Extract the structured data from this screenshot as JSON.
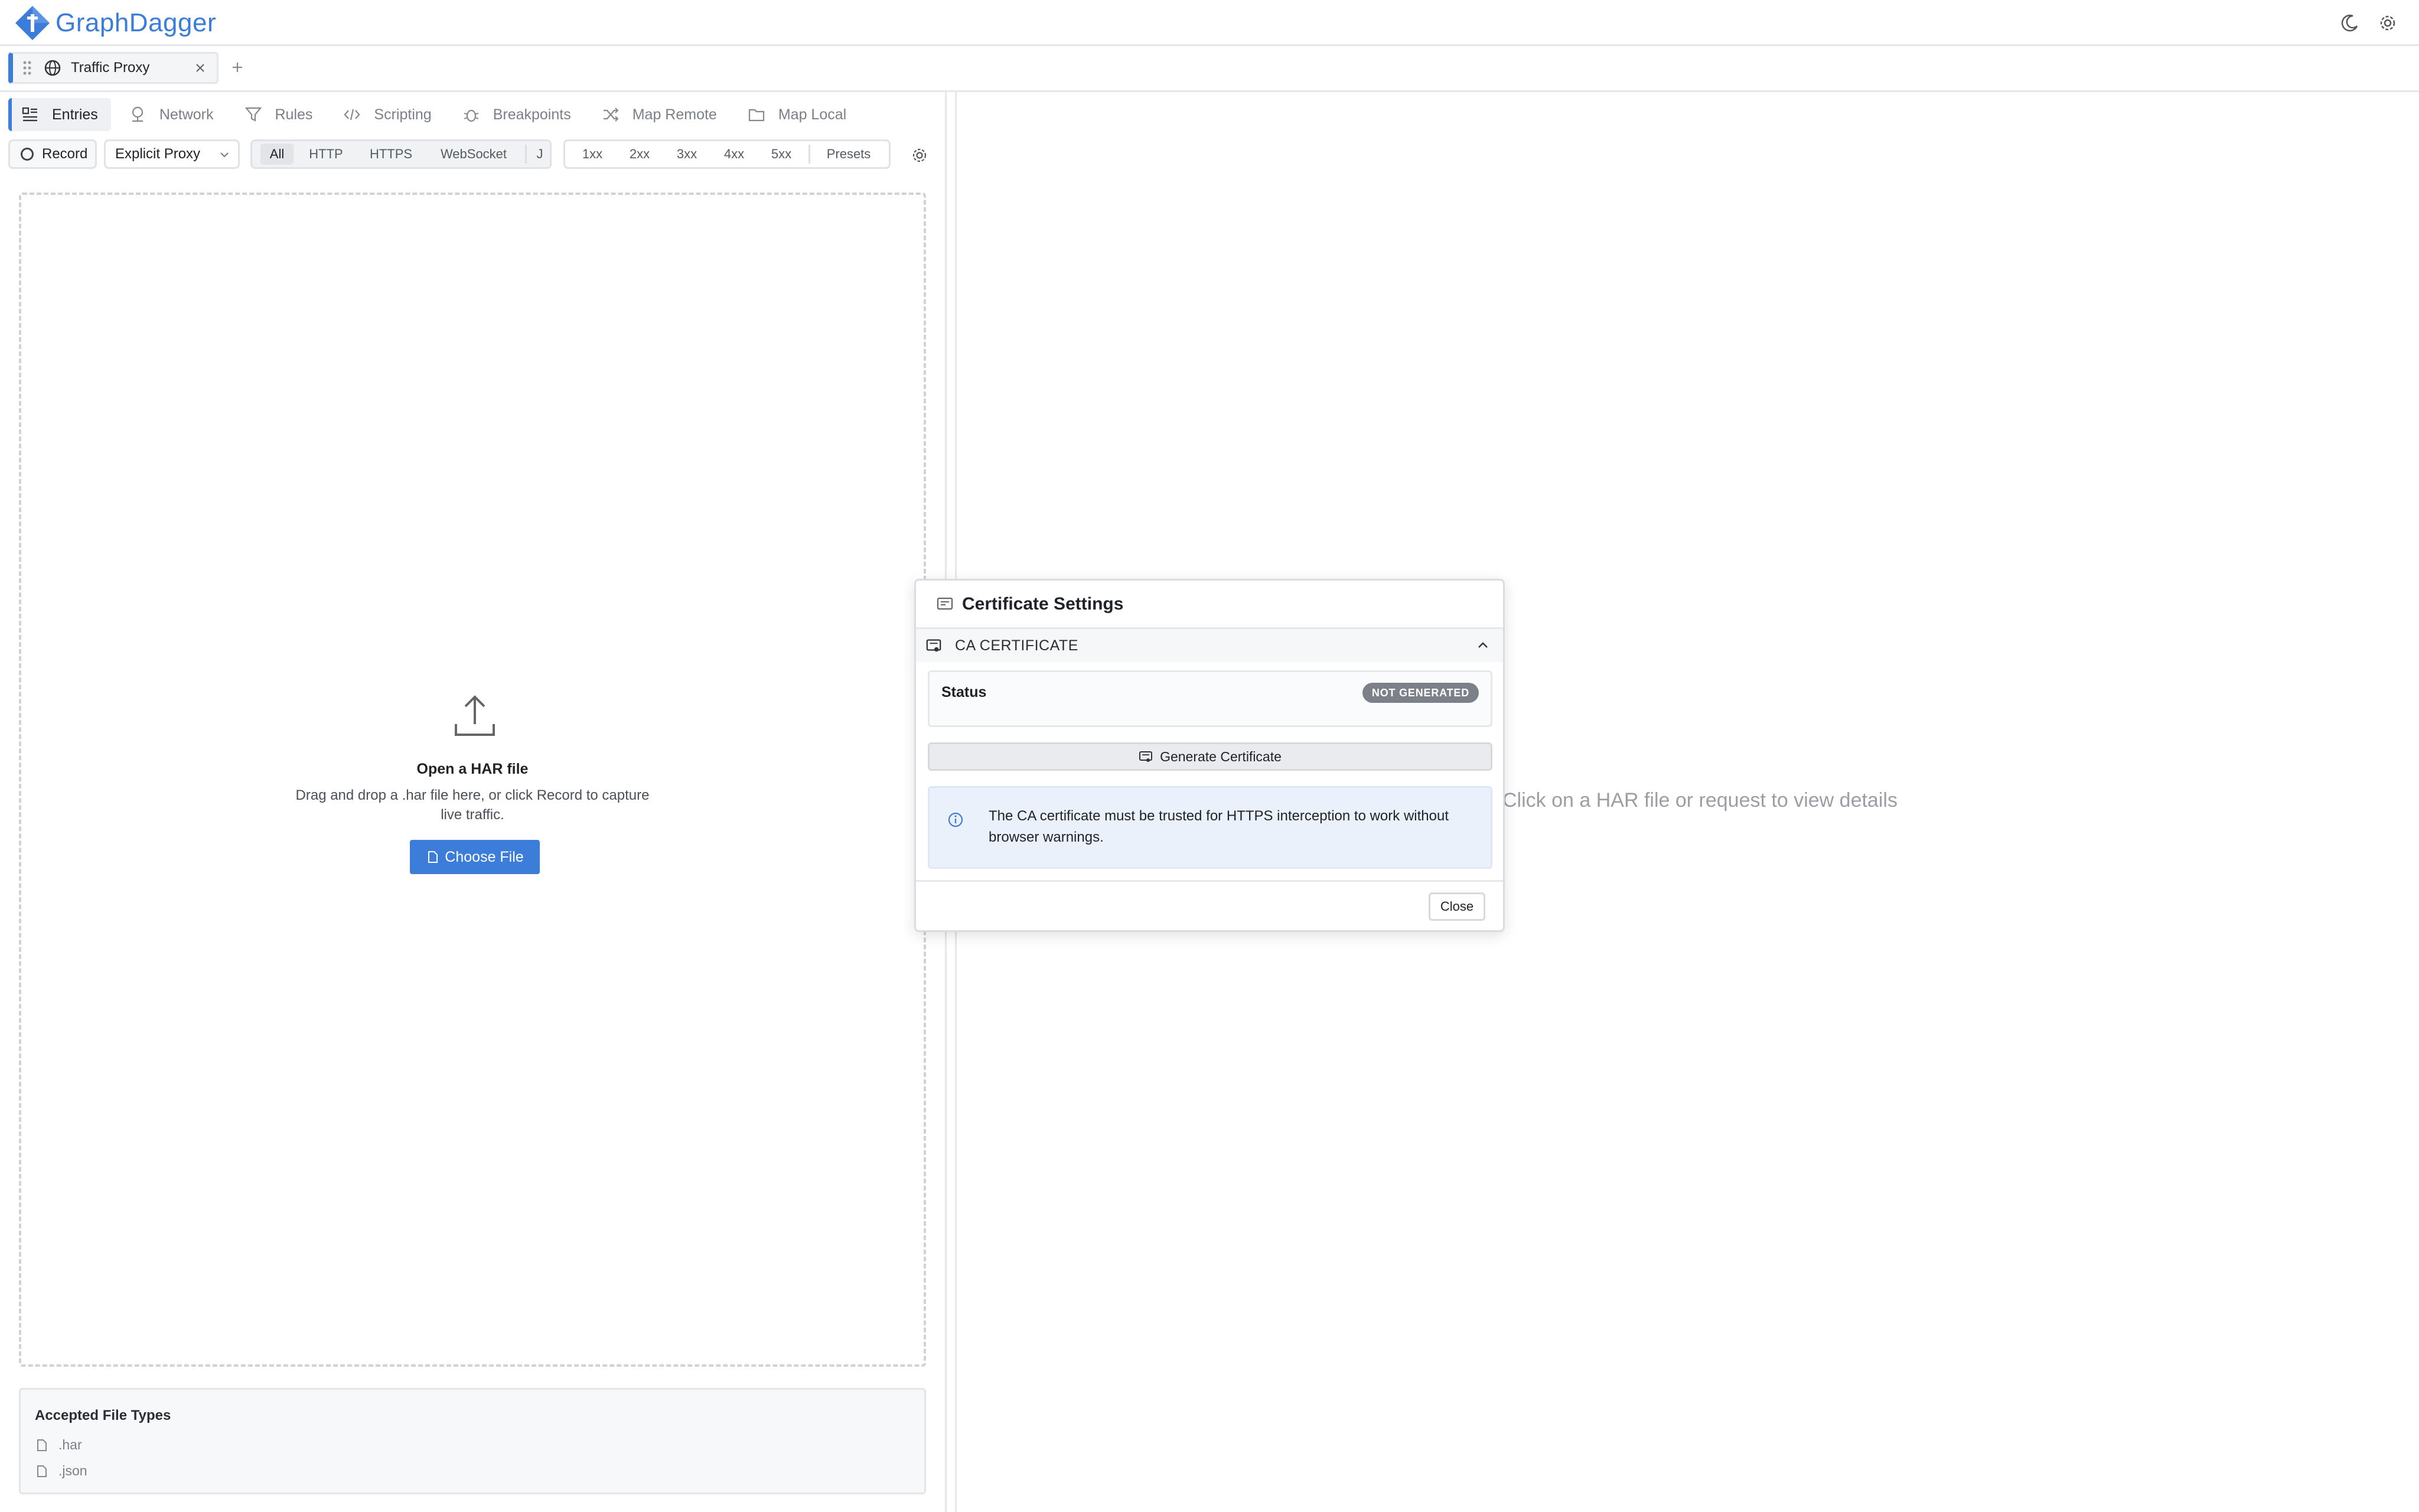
{
  "app": {
    "name": "GraphDagger"
  },
  "colors": {
    "accent": "#3b7dd8",
    "badge": "#7c8088",
    "info_bg": "#eaf1fb"
  },
  "header": {
    "icons": [
      "moon-icon",
      "gear-icon"
    ]
  },
  "tabs": [
    {
      "label": "Traffic Proxy",
      "icon": "globe-icon",
      "active": true
    }
  ],
  "nav": {
    "items": [
      {
        "label": "Entries",
        "icon": "list-icon",
        "active": true
      },
      {
        "label": "Network",
        "icon": "network-icon"
      },
      {
        "label": "Rules",
        "icon": "filter-icon"
      },
      {
        "label": "Scripting",
        "icon": "code-icon"
      },
      {
        "label": "Breakpoints",
        "icon": "bug-icon"
      },
      {
        "label": "Map Remote",
        "icon": "shuffle-icon"
      },
      {
        "label": "Map Local",
        "icon": "folder-icon"
      }
    ]
  },
  "filters": {
    "record_label": "Record",
    "proxy_mode": "Explicit Proxy",
    "protocols": [
      "All",
      "HTTP",
      "HTTPS",
      "WebSocket",
      "J"
    ],
    "active_protocol": "All",
    "status_codes": [
      "1xx",
      "2xx",
      "3xx",
      "4xx",
      "5xx"
    ],
    "presets_label": "Presets"
  },
  "dropzone": {
    "title": "Open a HAR file",
    "description": "Drag and drop a .har file here, or click Record to capture live traffic.",
    "button_label": "Choose File"
  },
  "accepted": {
    "title": "Accepted File Types",
    "types": [
      ".har",
      ".json"
    ]
  },
  "detail": {
    "placeholder": "Click on a HAR file or request to view details"
  },
  "modal": {
    "title": "Certificate Settings",
    "section_label": "CA CERTIFICATE",
    "status_label": "Status",
    "status_value": "NOT GENERATED",
    "generate_label": "Generate Certificate",
    "info_text": "The CA certificate must be trusted for HTTPS interception to work without browser warnings.",
    "close_label": "Close"
  }
}
